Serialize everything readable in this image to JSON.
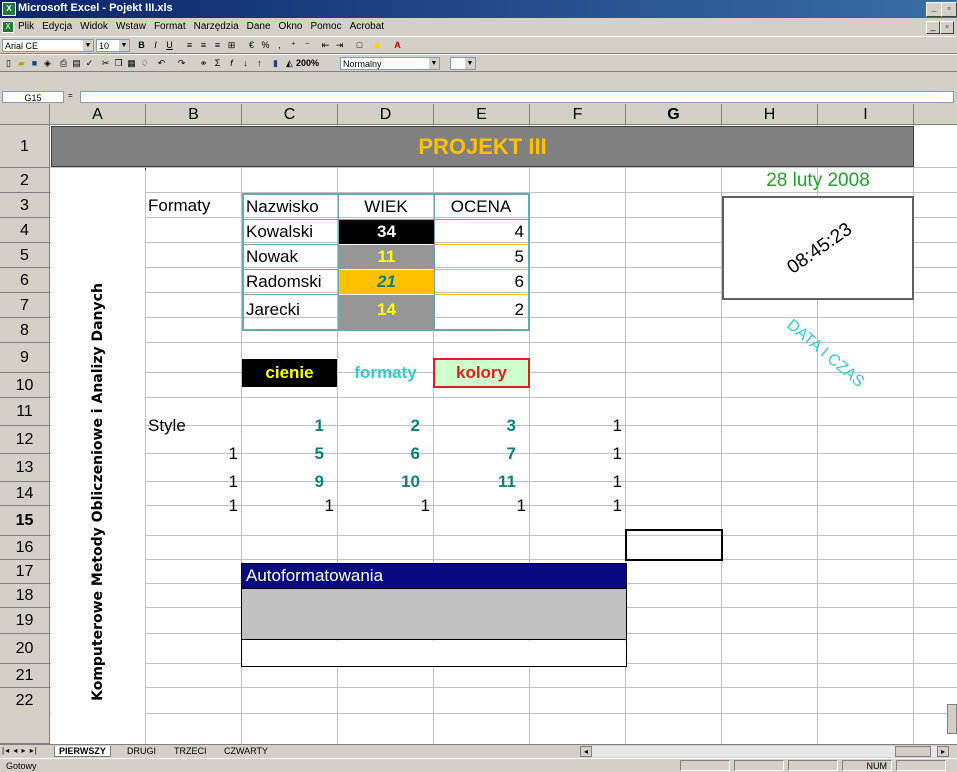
{
  "window": {
    "title": "Microsoft Excel - Pojekt III.xls"
  },
  "menu": [
    "Plik",
    "Edycja",
    "Widok",
    "Wstaw",
    "Format",
    "Narzędzia",
    "Dane",
    "Okno",
    "Pomoc",
    "Acrobat"
  ],
  "toolbar": {
    "font": "Arial CE",
    "size": "10",
    "zoom": "200%",
    "style": "Normalny"
  },
  "formula": {
    "name_box": "G15"
  },
  "columns": [
    "A",
    "B",
    "C",
    "D",
    "E",
    "F",
    "G",
    "H",
    "I"
  ],
  "rows": [
    "1",
    "2",
    "3",
    "4",
    "5",
    "6",
    "7",
    "8",
    "9",
    "10",
    "11",
    "12",
    "13",
    "14",
    "15",
    "16",
    "17",
    "18",
    "19",
    "20",
    "21",
    "22"
  ],
  "sheet": {
    "title": "PROJEKT III",
    "vertical_text": "Komputerowe Metody Obliczeniowe i Analizy Danych",
    "formaty_label": "Formaty",
    "table": {
      "headers": [
        "Nazwisko",
        "WIEK",
        "OCENA"
      ],
      "rows": [
        {
          "name": "Kowalski",
          "age": "34",
          "grade": "4"
        },
        {
          "name": "Nowak",
          "age": "11",
          "grade": "5"
        },
        {
          "name": "Radomski",
          "age": "21",
          "grade": "6"
        },
        {
          "name": "Jarecki",
          "age": "14",
          "grade": "2"
        }
      ]
    },
    "labels": {
      "cienie": "cienie",
      "formaty": "formaty",
      "kolory": "kolory"
    },
    "style_label": "Style",
    "grid": [
      [
        "",
        "1",
        "2",
        "3",
        "1"
      ],
      [
        "1",
        "5",
        "6",
        "7",
        "1"
      ],
      [
        "1",
        "9",
        "10",
        "11",
        "1"
      ],
      [
        "1",
        "1",
        "1",
        "1",
        "1"
      ]
    ],
    "autoformat_label": "Autoformatowania",
    "date": "28 luty 2008",
    "time": "08:45:23",
    "data_czas": "DATA I CZAS"
  },
  "tabs": [
    "PIERWSZY",
    "DRUGI",
    "TRZECI",
    "CZWARTY"
  ],
  "status": {
    "left": "Gotowy",
    "num": "NUM"
  },
  "colors": {
    "title_bar": "#808080",
    "title_text": "#ffc000",
    "teal": "#0e7f7f",
    "date_green": "#22a02a",
    "data_czas": "#33cccc",
    "navy": "#0a0a80"
  }
}
